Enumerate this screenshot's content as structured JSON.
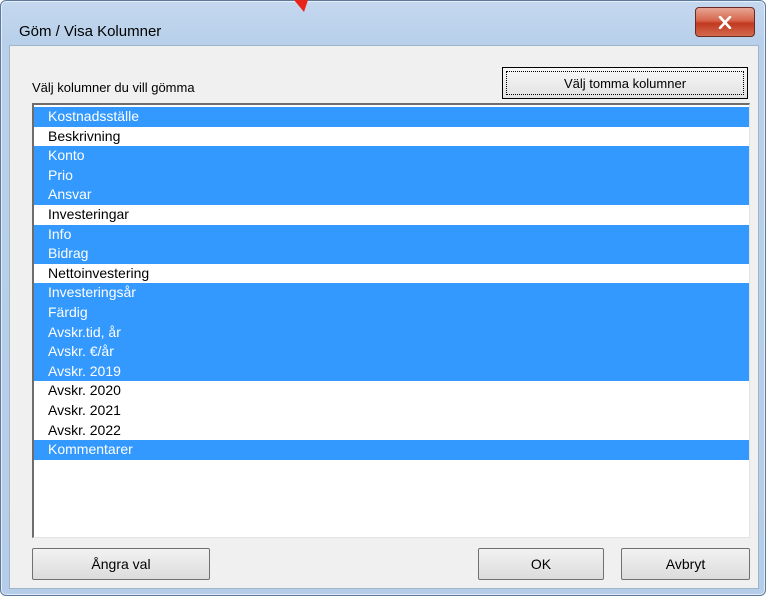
{
  "window": {
    "title": "Göm / Visa Kolumner"
  },
  "dialog": {
    "list_label": "Välj kolumner du vill gömma",
    "select_empty_label": "Välj tomma kolumner",
    "undo_label": "Ångra val",
    "ok_label": "OK",
    "cancel_label": "Avbryt"
  },
  "columns": [
    {
      "label": "Kostnadsställe",
      "selected": true
    },
    {
      "label": "Beskrivning",
      "selected": false
    },
    {
      "label": "Konto",
      "selected": true
    },
    {
      "label": "Prio",
      "selected": true
    },
    {
      "label": "Ansvar",
      "selected": true
    },
    {
      "label": "Investeringar",
      "selected": false
    },
    {
      "label": "Info",
      "selected": true
    },
    {
      "label": "Bidrag",
      "selected": true
    },
    {
      "label": "Nettoinvestering",
      "selected": false
    },
    {
      "label": "Investeringsår",
      "selected": true
    },
    {
      "label": "Färdig",
      "selected": true
    },
    {
      "label": "Avskr.tid, år",
      "selected": true
    },
    {
      "label": "Avskr. €/år",
      "selected": true
    },
    {
      "label": "Avskr. 2019",
      "selected": true
    },
    {
      "label": "Avskr. 2020",
      "selected": false
    },
    {
      "label": "Avskr. 2021",
      "selected": false
    },
    {
      "label": "Avskr. 2022",
      "selected": false
    },
    {
      "label": "Kommentarer",
      "selected": true
    }
  ],
  "colors": {
    "selection": "#3399ff",
    "close_button": "#c94a2c",
    "pointer": "#e8241a"
  },
  "icons": {
    "close": "close-icon"
  }
}
